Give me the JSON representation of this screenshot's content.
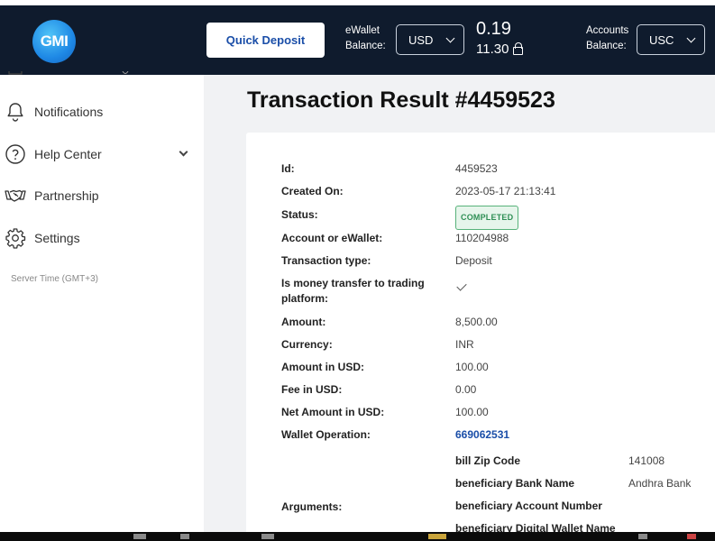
{
  "header": {
    "logo_text": "GMI",
    "quick_deposit_label": "Quick Deposit",
    "ewallet_label_line1": "eWallet",
    "ewallet_label_line2": "Balance:",
    "ewallet_currency": "USD",
    "balance_main": "0.19",
    "balance_locked": "11.30",
    "accounts_label_line1": "Accounts",
    "accounts_label_line2": "Balance:",
    "accounts_currency": "USC"
  },
  "sidebar": {
    "items": [
      {
        "label": "Notifications",
        "icon": "bell-icon"
      },
      {
        "label": "Help Center",
        "icon": "help-circle-icon"
      },
      {
        "label": "Partnership",
        "icon": "handshake-icon"
      },
      {
        "label": "Settings",
        "icon": "gear-icon"
      }
    ],
    "server_time": "Server Time (GMT+3)"
  },
  "main": {
    "title": "Transaction Result #4459523",
    "details": {
      "id_label": "Id:",
      "id_value": "4459523",
      "created_label": "Created On:",
      "created_value": "2023-05-17 21:13:41",
      "status_label": "Status:",
      "status_value": "COMPLETED",
      "account_label": "Account or eWallet:",
      "account_value": "110204988",
      "type_label": "Transaction type:",
      "type_value": "Deposit",
      "transfer_label": "Is money transfer to trading platform:",
      "transfer_value": true,
      "amount_label": "Amount:",
      "amount_value": "8,500.00",
      "currency_label": "Currency:",
      "currency_value": "INR",
      "amount_usd_label": "Amount in USD:",
      "amount_usd_value": "100.00",
      "fee_label": "Fee in USD:",
      "fee_value": "0.00",
      "net_label": "Net Amount in USD:",
      "net_value": "100.00",
      "wallet_op_label": "Wallet Operation:",
      "wallet_op_value": "669062531",
      "arguments_label": "Arguments:"
    },
    "arguments": [
      {
        "key": "bill Zip Code",
        "value": "141008"
      },
      {
        "key": "beneficiary Bank Name",
        "value": "Andhra Bank"
      },
      {
        "key": "beneficiary Account Number",
        "value": ""
      },
      {
        "key": "beneficiary Digital Wallet Name",
        "value": ""
      }
    ]
  },
  "colors": {
    "header_bg": "#0f1b2d",
    "accent_blue": "#1a4ea8",
    "status_green": "#2f8f55",
    "main_bg": "#f1f2f4"
  }
}
